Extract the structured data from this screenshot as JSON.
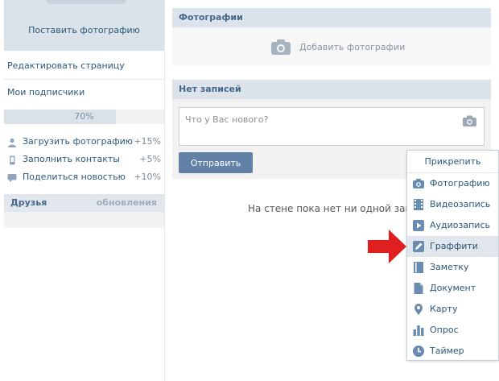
{
  "left": {
    "avatar_link": "Поставить фотографию",
    "edit_page": "Редактировать страницу",
    "subscriptions": "Мои подписчики",
    "progress": {
      "text": "70%",
      "fraction": 0.7
    },
    "tasks": [
      {
        "label": "Загрузить фотографию",
        "bonus": "+15%",
        "icon": "user-icon"
      },
      {
        "label": "Заполнить контакты",
        "bonus": "+5%",
        "icon": "phone-icon"
      },
      {
        "label": "Поделиться новостью",
        "bonus": "+10%",
        "icon": "speech-bubble-icon"
      }
    ],
    "friends": {
      "title": "Друзья",
      "updates": "обновления"
    }
  },
  "photos": {
    "title": "Фотографии",
    "add_label": "Добавить фотографии"
  },
  "wall": {
    "title": "Нет записей",
    "placeholder": "Что у Вас нового?",
    "send_label": "Отправить",
    "empty_text": "На стене пока нет ни одной записи"
  },
  "attach_menu": {
    "title": "Прикрепить",
    "items": [
      {
        "label": "Фотографию",
        "icon": "camera-icon"
      },
      {
        "label": "Видеозапись",
        "icon": "film-icon"
      },
      {
        "label": "Аудиозапись",
        "icon": "play-icon"
      },
      {
        "label": "Граффити",
        "icon": "pencil-icon"
      },
      {
        "label": "Заметку",
        "icon": "note-icon"
      },
      {
        "label": "Документ",
        "icon": "document-icon"
      },
      {
        "label": "Карту",
        "icon": "map-pin-icon"
      },
      {
        "label": "Опрос",
        "icon": "poll-icon"
      },
      {
        "label": "Таймер",
        "icon": "clock-icon"
      }
    ],
    "highlighted": "Граффити"
  },
  "colors": {
    "link": "#2b587a",
    "accent": "#6181a6",
    "header_bg": "#dde3ea",
    "icon": "#6a8cb1",
    "arrow": "#e02020"
  }
}
